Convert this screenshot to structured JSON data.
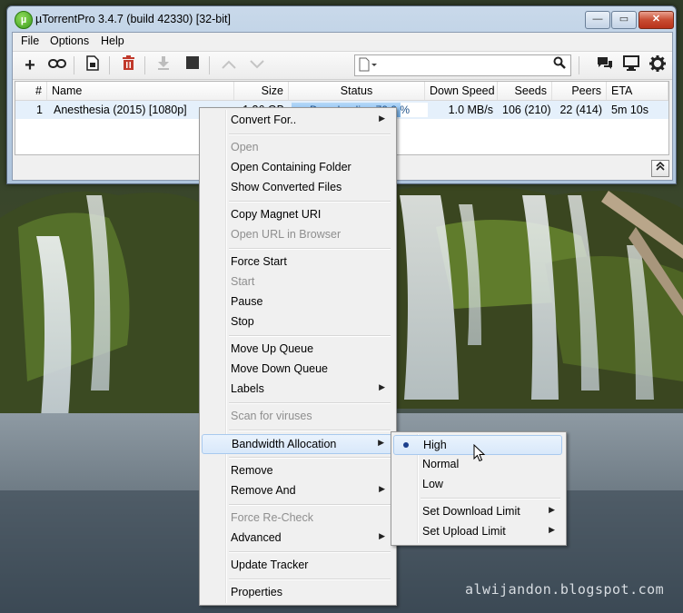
{
  "window": {
    "title": "µTorrentPro 3.4.7  (build 42330) [32-bit]",
    "app_logo_letter": "µ",
    "minimize_glyph": "—",
    "maximize_glyph": "▭",
    "close_glyph": "✕"
  },
  "menubar": {
    "items": [
      "File",
      "Options",
      "Help"
    ]
  },
  "toolbar": {
    "icons": [
      "add-torrent-icon",
      "add-url-link-icon",
      "create-torrent-icon",
      "remove-torrent-icon",
      "start-download-icon",
      "stop-icon",
      "move-up-icon",
      "move-down-icon",
      "chat-icon",
      "remote-monitor-icon",
      "settings-gear-icon"
    ],
    "search_value": "",
    "accent_remove": "#c0392b"
  },
  "list": {
    "columns": [
      "#",
      "Name",
      "Size",
      "Status",
      "Down Speed",
      "Seeds",
      "Peers",
      "ETA"
    ],
    "rows": [
      {
        "num": "1",
        "name": "Anesthesia (2015) [1080p]",
        "size": "1.36 GB",
        "status": "Downloading 79.9 %",
        "progress": 0.799,
        "down_speed": "1.0 MB/s",
        "seeds": "106 (210)",
        "peers": "22 (414)",
        "eta": "5m 10s"
      }
    ],
    "progress_color": "#74b3ee"
  },
  "context_menu": {
    "items": [
      {
        "label": "Convert For..",
        "submenu": true
      },
      {
        "label": "Open",
        "disabled": true
      },
      {
        "label": "Open Containing Folder"
      },
      {
        "label": "Show Converted Files"
      },
      {
        "label": "Copy Magnet URI"
      },
      {
        "label": "Open URL in Browser",
        "disabled": true
      },
      {
        "label": "Force Start"
      },
      {
        "label": "Start",
        "disabled": true
      },
      {
        "label": "Pause"
      },
      {
        "label": "Stop"
      },
      {
        "label": "Move Up Queue"
      },
      {
        "label": "Move Down Queue"
      },
      {
        "label": "Labels",
        "submenu": true
      },
      {
        "label": "Scan for viruses",
        "disabled": true
      },
      {
        "label": "Bandwidth Allocation",
        "submenu": true,
        "highlighted": true
      },
      {
        "label": "Remove"
      },
      {
        "label": "Remove And",
        "submenu": true
      },
      {
        "label": "Force Re-Check",
        "disabled": true
      },
      {
        "label": "Advanced",
        "submenu": true
      },
      {
        "label": "Update Tracker"
      },
      {
        "label": "Properties"
      }
    ]
  },
  "bandwidth_submenu": {
    "items": [
      {
        "label": "High",
        "selected": true,
        "highlighted": true
      },
      {
        "label": "Normal"
      },
      {
        "label": "Low"
      },
      {
        "label": "Set Download Limit",
        "submenu": true
      },
      {
        "label": "Set Upload Limit",
        "submenu": true
      }
    ]
  },
  "watermark": "alwijandon.blogspot.com"
}
